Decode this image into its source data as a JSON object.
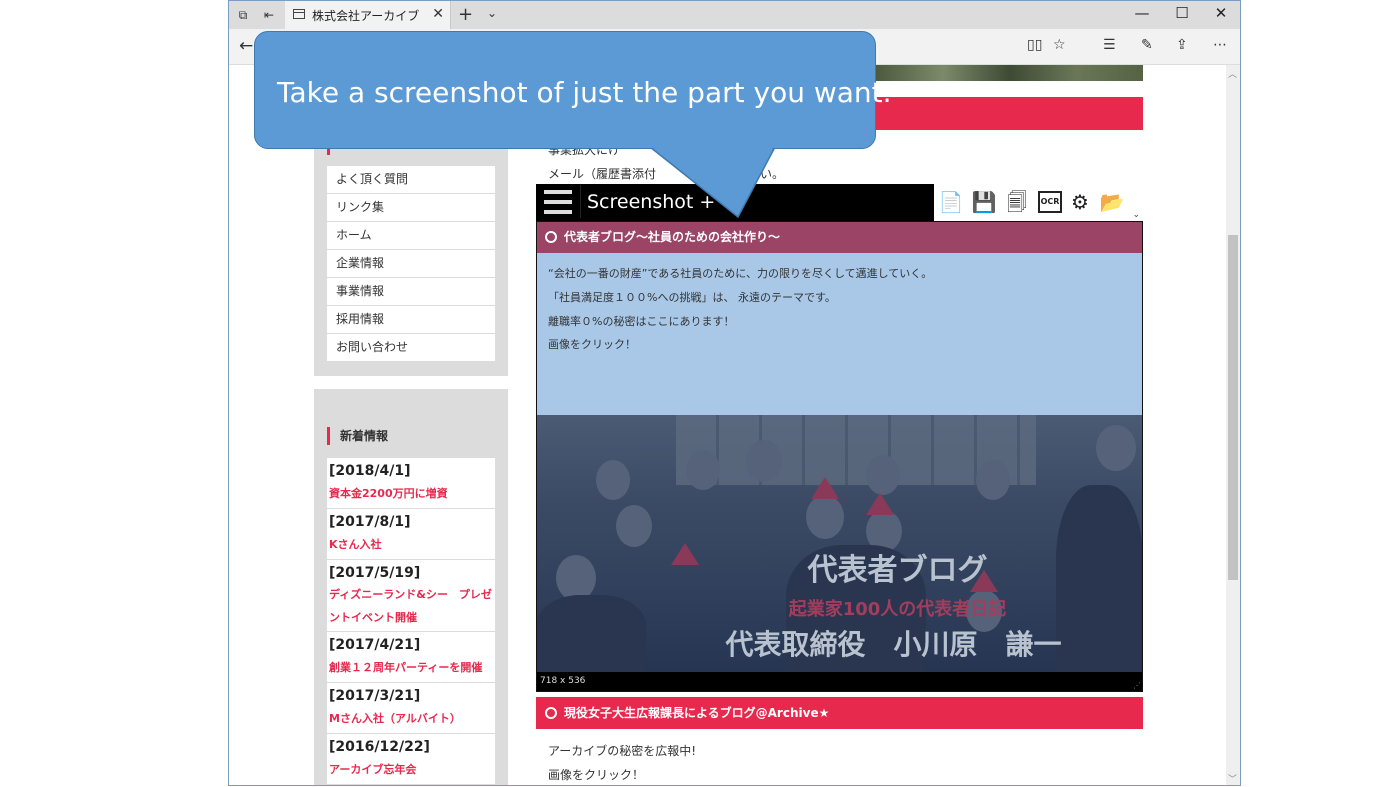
{
  "browser": {
    "tab_title": "株式会社アーカイブ",
    "tab_close_glyph": "✕",
    "new_tab_glyph": "+",
    "tab_menu_glyph": "⌄",
    "minimize_glyph": "—",
    "maximize_glyph": "☐",
    "close_glyph": "✕",
    "back_glyph": "←",
    "more_glyph": "⋯",
    "icons": [
      "tab-aside-icon",
      "tab-restore-icon",
      "reading-view-icon",
      "favorite-star-icon",
      "favorites-hub-icon",
      "pen-icon",
      "share-icon"
    ]
  },
  "page": {
    "snippet_line1": "事業拡大にけ",
    "snippet_line2": "メール（履歴書添付",
    "snippet_line2_end": "い。",
    "sidebar_menu": [
      "よく頂く質問",
      "リンク集",
      "ホーム",
      "企業情報",
      "事業情報",
      "採用情報",
      "お問い合わせ"
    ],
    "news_title": "新着情報",
    "news": [
      {
        "date": "[2018/4/1]",
        "text": "資本金2200万円に増資"
      },
      {
        "date": "[2017/8/1]",
        "text": "Kさん入社"
      },
      {
        "date": "[2017/5/19]",
        "text": "ディズニーランド&シー　プレゼントイベント開催"
      },
      {
        "date": "[2017/4/21]",
        "text": "創業１２周年パーティーを開催"
      },
      {
        "date": "[2017/3/21]",
        "text": "Mさん入社（アルバイト）"
      },
      {
        "date": "[2016/12/22]",
        "text": "アーカイブ忘年会"
      }
    ],
    "blog1_header": "代表者ブログ～社員のための会社作り～",
    "blog1_lines": [
      "“会社の一番の財産”である社員のために、力の限りを尽くして邁進していく。",
      "「社員満足度１００%への挑戦」は、 永遠のテーマです。",
      "離職率０%の秘密はここにあります！",
      "画像をクリック！"
    ],
    "photo_title": "代表者ブログ",
    "photo_subtitle": "起業家100人の代表者日記",
    "photo_name": "代表取締役　小川原　謙一",
    "dimensions": "718 x 536",
    "blog2_header": "現役女子大生広報課長によるブログ@Archive★",
    "blog2_lines": [
      "アーカイブの秘密を広報中!",
      "画像をクリック！"
    ]
  },
  "screenshot_tool": {
    "title": "Screenshot +",
    "ocr_label": "OCR",
    "tools": [
      "copy-icon",
      "save-icon",
      "save-all-icon",
      "ocr-icon",
      "settings-gear-icon",
      "folder-open-icon"
    ]
  },
  "callout": {
    "text": "Take a screenshot of just the part you want."
  },
  "colors": {
    "accent_red": "#e8294e",
    "callout_blue": "#5b9ad5",
    "blog_body_blue": "#a9c8e8",
    "blog_header_mauve": "#9b4466"
  }
}
